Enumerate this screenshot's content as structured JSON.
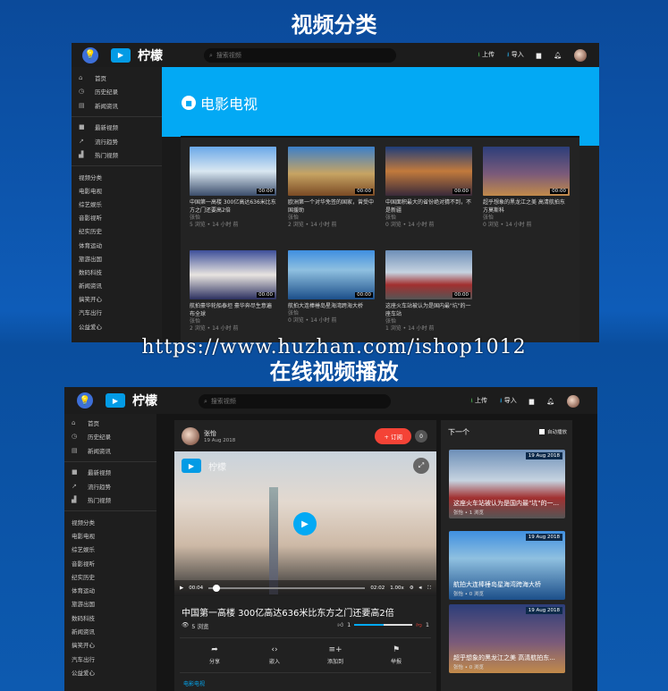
{
  "titles": {
    "top": "视频分类",
    "bottom": "在线视频播放",
    "watermark": "https://www.huzhan.com/ishop1012"
  },
  "header": {
    "brand": "柠檬",
    "search_placeholder": "搜索视频",
    "upload": "上传",
    "import": "导入"
  },
  "sidebar": {
    "main": [
      "首页",
      "历史纪录",
      "新闻资讯"
    ],
    "discover": [
      "最新视频",
      "流行趋势",
      "热门视频"
    ],
    "categories": [
      "视频分类",
      "电影电视",
      "综艺娱乐",
      "音影视听",
      "纪实历史",
      "体育运动",
      "旅游出国",
      "数码科技",
      "新闻资讯",
      "搞笑开心",
      "汽车出行",
      "公益爱心"
    ]
  },
  "category_page": {
    "title": "电影电视",
    "videos": [
      {
        "title": "中国第一高楼 300亿高达636米比东方之门还要高2倍",
        "author": "张怡",
        "meta": "5 浏览 • 14 小时 前",
        "duration": "00:00"
      },
      {
        "title": "欧洲第一个对华免签的国家，曾受中国援助",
        "author": "张怡",
        "meta": "2 浏览 • 14 小时 前",
        "duration": "00:00"
      },
      {
        "title": "中国面积最大的省份绝对猜不到，不是新疆",
        "author": "张怡",
        "meta": "0 浏览 • 14 小时 前",
        "duration": "00:00"
      },
      {
        "title": "超乎想象的黑龙江之美 高清航拍东方莫斯科",
        "author": "张怡",
        "meta": "0 浏览 • 14 小时 前",
        "duration": "00:00"
      },
      {
        "title": "航拍豪华轮船泰坦 豪华奔尽生意遍布全球",
        "author": "张怡",
        "meta": "2 浏览 • 14 小时 前",
        "duration": "00:00"
      },
      {
        "title": "航拍大连棒棰岛星海湾跨海大桥",
        "author": "张怡",
        "meta": "0 浏览 • 14 小时 前",
        "duration": "00:00"
      },
      {
        "title": "这座火车站被认为是国内最\"坑\"的一座车站",
        "author": "张怡",
        "meta": "1 浏览 • 14 小时 前",
        "duration": "00:00"
      }
    ]
  },
  "player_page": {
    "channel": {
      "name": "张怡",
      "date": "19 Aug 2018",
      "subscribe": "+ 订阅",
      "subscribers": "0"
    },
    "player": {
      "brand": "柠檬",
      "current": "00:04",
      "total": "02:02",
      "speed": "1.00x",
      "progress": 0.03
    },
    "video": {
      "title": "中国第一高楼 300亿高达636米比东方之门还要高2倍",
      "views": "5 浏览",
      "likes": "1",
      "dislikes": "1",
      "like_ratio": 0.5
    },
    "actions": [
      "分享",
      "嵌入",
      "添加到",
      "举报"
    ],
    "category_link": "电影电视",
    "next": {
      "title": "下一个",
      "autoplay": "自动播放",
      "items": [
        {
          "title": "这座火车站被认为是国内最\"坑\"的一...",
          "meta": "张怡 • 1 浏览",
          "date": "19 Aug 2018"
        },
        {
          "title": "航拍大连棒棰岛星海湾跨海大桥",
          "meta": "张怡 • 0 浏览",
          "date": "19 Aug 2018"
        },
        {
          "title": "超乎想象的黑龙江之美 高清航拍东...",
          "meta": "张怡 • 0 浏览",
          "date": "19 Aug 2018"
        }
      ]
    }
  }
}
